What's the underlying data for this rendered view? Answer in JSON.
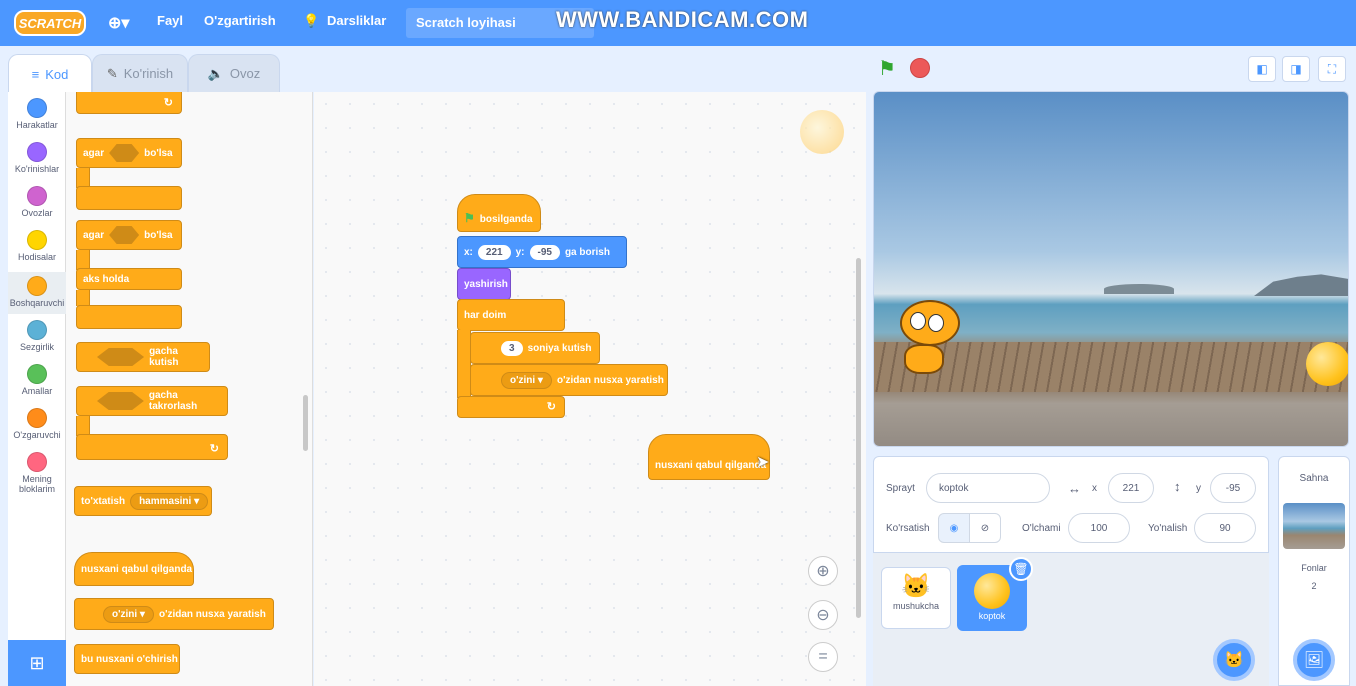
{
  "menubar": {
    "logo": "SCRATCH",
    "globe_icon": "globe-icon",
    "file": "Fayl",
    "edit": "O'zgartirish",
    "tutorials": "Darsliklar",
    "project_title": "Scratch loyihasi"
  },
  "watermark": "WWW.BANDICAM.COM",
  "tabs": {
    "code": "Kod",
    "costumes": "Ko'rinish",
    "sounds": "Ovoz"
  },
  "categories": [
    {
      "label": "Harakatlar",
      "color": "#4c97ff"
    },
    {
      "label": "Ko'rinishlar",
      "color": "#9966ff"
    },
    {
      "label": "Ovozlar",
      "color": "#cf63cf"
    },
    {
      "label": "Hodisalar",
      "color": "#ffd500"
    },
    {
      "label": "Boshqaruvchi",
      "color": "#ffab19"
    },
    {
      "label": "Sezgirlik",
      "color": "#5cb1d6"
    },
    {
      "label": "Amallar",
      "color": "#59c059"
    },
    {
      "label": "O'zgaruvchi",
      "color": "#ff8c1a"
    },
    {
      "label": "Mening bloklarim",
      "color": "#ff6680"
    }
  ],
  "palette": {
    "if_1": "agar",
    "then_1": "bo'lsa",
    "if_2": "agar",
    "then_2": "bo'lsa",
    "else": "aks holda",
    "wait_until": "gacha kutish",
    "repeat_until": "gacha takrorlash",
    "stop": "to'xtatish",
    "stop_option": "hammasini",
    "when_clone": "nusxani qabul qilganda",
    "clone_option": "o'zini",
    "create_clone": "o'zidan nusxa yaratish",
    "delete_clone": "bu nusxani o'chirish"
  },
  "script": {
    "hat": "bosilganda",
    "goto_x_label": "x:",
    "goto_x": "221",
    "goto_y_label": "y:",
    "goto_y": "-95",
    "goto_suffix": "ga borish",
    "hide": "yashirish",
    "forever": "har doim",
    "wait_value": "3",
    "wait_label": "soniya kutish",
    "clone_option": "o'zini",
    "clone_label": "o'zidan nusxa yaratish",
    "dragged_block": "nusxani qabul qilganda"
  },
  "sprite_info": {
    "sprite_label": "Sprayt",
    "sprite_name": "koptok",
    "x_label": "x",
    "x": "221",
    "y_label": "y",
    "y": "-95",
    "show_label": "Ko'rsatish",
    "size_label": "O'lchami",
    "size": "100",
    "direction_label": "Yo'nalish",
    "direction": "90"
  },
  "sprites": [
    {
      "name": "mushukcha"
    },
    {
      "name": "koptok"
    }
  ],
  "stage_pane": {
    "title": "Sahna",
    "backdrops_label": "Fonlar",
    "backdrops_count": "2"
  },
  "colors": {
    "accent": "#4c97ff",
    "control": "#ffab19",
    "motion": "#4c97ff",
    "looks": "#9966ff"
  }
}
